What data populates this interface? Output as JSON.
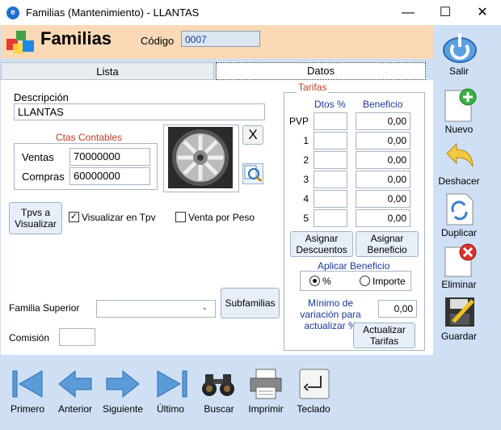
{
  "window": {
    "title": "Familias (Mantenimiento) - LLANTAS",
    "minimize": "—",
    "maximize": "☐",
    "close": "✕"
  },
  "header": {
    "title": "Familias",
    "codigo_label": "Código",
    "codigo_value": "0007"
  },
  "tabs": [
    {
      "label": "Lista",
      "active": false
    },
    {
      "label": "Datos",
      "active": true
    }
  ],
  "descripcion": {
    "label": "Descripción",
    "value": "LLANTAS"
  },
  "ctas": {
    "title": "Ctas Contables",
    "ventas_label": "Ventas",
    "ventas_value": "70000000",
    "compras_label": "Compras",
    "compras_value": "60000000"
  },
  "image": {
    "clear_label": "X"
  },
  "tpvs_button": "Tpvs a Visualizar",
  "visualizar_tpv": {
    "label": "Visualizar en Tpv",
    "checked": true
  },
  "venta_peso": {
    "label": "Venta por Peso",
    "checked": false
  },
  "familia_superior": {
    "label": "Familia Superior",
    "value": ""
  },
  "subfamilias_button": "Subfamilias",
  "comision": {
    "label": "Comisión",
    "value": ""
  },
  "tarifas": {
    "title": "Tarifas",
    "col_dtos": "Dtos %",
    "col_beneficio": "Beneficio",
    "rows": [
      {
        "label": "PVP",
        "dto": "",
        "beneficio": "0,00"
      },
      {
        "label": "1",
        "dto": "",
        "beneficio": "0,00"
      },
      {
        "label": "2",
        "dto": "",
        "beneficio": "0,00"
      },
      {
        "label": "3",
        "dto": "",
        "beneficio": "0,00"
      },
      {
        "label": "4",
        "dto": "",
        "beneficio": "0,00"
      },
      {
        "label": "5",
        "dto": "",
        "beneficio": "0,00"
      }
    ],
    "asignar_descuentos": "Asignar Descuentos",
    "asignar_beneficio": "Asignar Beneficio",
    "aplicar_title": "Aplicar Beneficio",
    "opt_percent": "%",
    "opt_importe": "Importe",
    "selected": "%",
    "minimo_label": "Mínimo de variación para actualizar %",
    "minimo_value": "0,00",
    "actualizar_button": "Actualizar Tarifas"
  },
  "right_toolbar": {
    "salir": "Salir",
    "nuevo": "Nuevo",
    "deshacer": "Deshacer",
    "duplicar": "Duplicar",
    "eliminar": "Eliminar",
    "guardar": "Guardar"
  },
  "bottom_toolbar": {
    "primero": "Primero",
    "anterior": "Anterior",
    "siguiente": "Siguiente",
    "ultimo": "Último",
    "buscar": "Buscar",
    "imprimir": "Imprimir",
    "teclado": "Teclado"
  },
  "colors": {
    "background": "#cfe0f5",
    "header": "#fad9b6",
    "accent_blue": "#1a3a9a",
    "accent_red": "#c0392b"
  }
}
